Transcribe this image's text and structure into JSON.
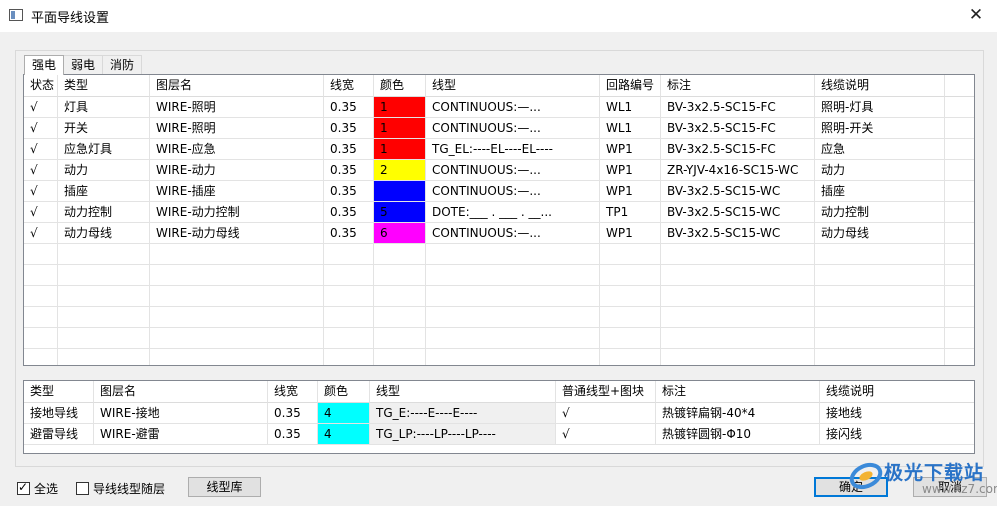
{
  "window": {
    "title": "平面导线设置",
    "close_glyph": "✕"
  },
  "tabs": [
    "强电",
    "弱电",
    "消防"
  ],
  "grid1": {
    "headers": [
      "状态",
      "类型",
      "图层名",
      "线宽",
      "颜色",
      "线型",
      "回路编号",
      "标注",
      "线缆说明"
    ],
    "rows": [
      {
        "status": "√",
        "type": "灯具",
        "layer": "WIRE-照明",
        "width": "0.35",
        "color_index": "1",
        "color": "#ff0000",
        "linetype": "CONTINUOUS:—...",
        "circuit": "WL1",
        "label": "BV-3x2.5-SC15-FC",
        "desc": "照明-灯具"
      },
      {
        "status": "√",
        "type": "开关",
        "layer": "WIRE-照明",
        "width": "0.35",
        "color_index": "1",
        "color": "#ff0000",
        "linetype": "CONTINUOUS:—...",
        "circuit": "WL1",
        "label": "BV-3x2.5-SC15-FC",
        "desc": "照明-开关"
      },
      {
        "status": "√",
        "type": "应急灯具",
        "layer": "WIRE-应急",
        "width": "0.35",
        "color_index": "1",
        "color": "#ff0000",
        "linetype": "TG_EL:----EL----EL----",
        "circuit": "WP1",
        "label": "BV-3x2.5-SC15-FC",
        "desc": "应急"
      },
      {
        "status": "√",
        "type": "动力",
        "layer": "WIRE-动力",
        "width": "0.35",
        "color_index": "2",
        "color": "#ffff00",
        "linetype": "CONTINUOUS:—...",
        "circuit": "WP1",
        "label": "ZR-YJV-4x16-SC15-WC",
        "desc": "动力"
      },
      {
        "status": "√",
        "type": "插座",
        "layer": "WIRE-插座",
        "width": "0.35",
        "color_index": "",
        "color": "#0000ff",
        "linetype": "CONTINUOUS:—...",
        "circuit": "WP1",
        "label": "BV-3x2.5-SC15-WC",
        "desc": "插座"
      },
      {
        "status": "√",
        "type": "动力控制",
        "layer": "WIRE-动力控制",
        "width": "0.35",
        "color_index": "5",
        "color": "#0000ff",
        "linetype": "DOTE:___ . ___ . __...",
        "circuit": "TP1",
        "label": "BV-3x2.5-SC15-WC",
        "desc": "动力控制"
      },
      {
        "status": "√",
        "type": "动力母线",
        "layer": "WIRE-动力母线",
        "width": "0.35",
        "color_index": "6",
        "color": "#ff00ff",
        "linetype": "CONTINUOUS:—...",
        "circuit": "WP1",
        "label": "BV-3x2.5-SC15-WC",
        "desc": "动力母线"
      }
    ]
  },
  "grid2": {
    "headers": [
      "类型",
      "图层名",
      "线宽",
      "颜色",
      "线型",
      "普通线型+图块",
      "标注",
      "线缆说明"
    ],
    "rows": [
      {
        "type": "接地导线",
        "layer": "WIRE-接地",
        "width": "0.35",
        "color_index": "4",
        "color": "#00ffff",
        "linetype": "TG_E:----E----E----",
        "block": "√",
        "label": "热镀锌扁钢-40*4",
        "desc": "接地线"
      },
      {
        "type": "避雷导线",
        "layer": "WIRE-避雷",
        "width": "0.35",
        "color_index": "4",
        "color": "#00ffff",
        "linetype": "TG_LP:----LP----LP----",
        "block": "√",
        "label": "热镀锌圆钢-Φ10",
        "desc": "接闪线"
      }
    ]
  },
  "footer": {
    "select_all_label": "全选",
    "select_all_checked": true,
    "follow_layer_label": "导线线型随层",
    "follow_layer_checked": false,
    "linetype_lib_button": "线型库",
    "ok_button": "确定",
    "cancel_button": "取消"
  },
  "watermark": {
    "text": "极光下载站",
    "url": "www.xz7.com"
  }
}
